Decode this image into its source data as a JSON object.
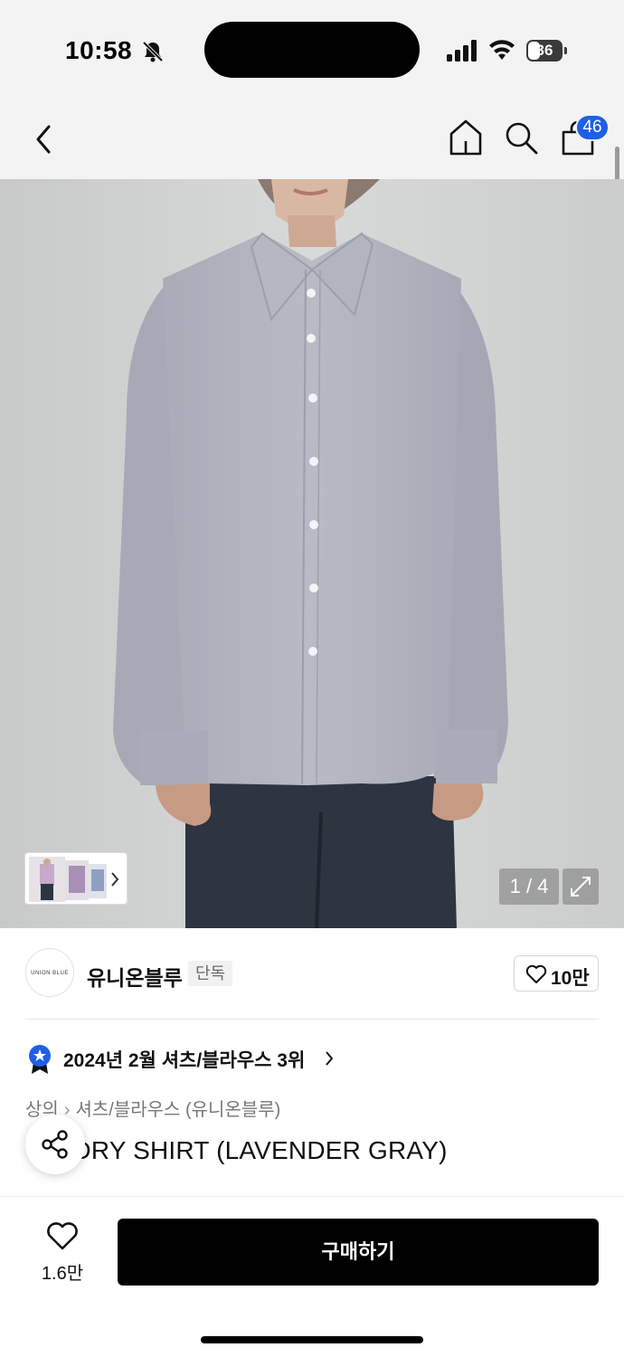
{
  "status_bar": {
    "time": "10:58",
    "battery": "36",
    "battery_level": 0.36,
    "icons": [
      "bell-slash-icon",
      "signal-icon",
      "wifi-icon",
      "battery-icon"
    ]
  },
  "nav": {
    "icons": [
      "back-chevron-icon",
      "home-icon",
      "search-icon",
      "shopping-bag-icon"
    ],
    "cart_count": "46"
  },
  "gallery": {
    "counter": "1 / 4"
  },
  "brand": {
    "logo_text": "UNION BLUE",
    "name": "유니온블루",
    "tag": "단독",
    "likes": "10만"
  },
  "rank": {
    "text": "2024년 2월 셔츠/블라우스 3위"
  },
  "breadcrumb": {
    "category": "상의",
    "subcategory": "셔츠/블라우스 (유니온블루)"
  },
  "product": {
    "title": "NDRY SHIRT (LAVENDER GRAY)"
  },
  "bottom": {
    "wish_count": "1.6만",
    "buy_label": "구매하기"
  },
  "colors": {
    "accent_blue": "#1f5fe8",
    "buy_button": "#000000",
    "shirt": "#b4b6c2"
  }
}
